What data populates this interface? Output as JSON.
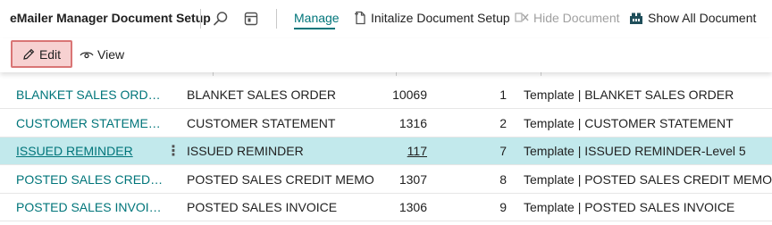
{
  "header": {
    "title": "eMailer Manager Document Setup",
    "manage_label": "Manage",
    "actions": [
      {
        "label": "Initalize Document Setup",
        "icon": "new-document-icon",
        "disabled": false
      },
      {
        "label": "Hide Document",
        "icon": "hide-document-icon",
        "disabled": true
      },
      {
        "label": "Show All Document",
        "icon": "show-all-icon",
        "disabled": false
      }
    ],
    "search_icon": "search-icon",
    "layout_icon": "layout-icon"
  },
  "subbar": {
    "edit_label": "Edit",
    "view_label": "View"
  },
  "colors": {
    "accent": "#00757a",
    "selected_row": "#c2e9ec",
    "edit_bg": "#f7d1d1",
    "edit_border": "#d97575"
  },
  "table": {
    "rows": [
      {
        "code": "BLANKET SALES ORDER",
        "description": "BLANKET SALES ORDER",
        "number": "10069",
        "line": "1",
        "template": "Template | BLANKET SALES ORDER",
        "selected": false
      },
      {
        "code": "CUSTOMER STATEMENT",
        "description": "CUSTOMER STATEMENT",
        "number": "1316",
        "line": "2",
        "template": "Template | CUSTOMER STATEMENT",
        "selected": false
      },
      {
        "code": "ISSUED REMINDER",
        "description": "ISSUED REMINDER",
        "number": "117",
        "line": "7",
        "template": "Template | ISSUED REMINDER-Level 5",
        "selected": true
      },
      {
        "code": "POSTED SALES CREDIT ...",
        "description": "POSTED SALES CREDIT MEMO",
        "number": "1307",
        "line": "8",
        "template": "Template | POSTED SALES CREDIT MEMO",
        "selected": false
      },
      {
        "code": "POSTED SALES INVOICE",
        "description": "POSTED SALES INVOICE",
        "number": "1306",
        "line": "9",
        "template": "Template | POSTED SALES INVOICE",
        "selected": false
      }
    ]
  }
}
